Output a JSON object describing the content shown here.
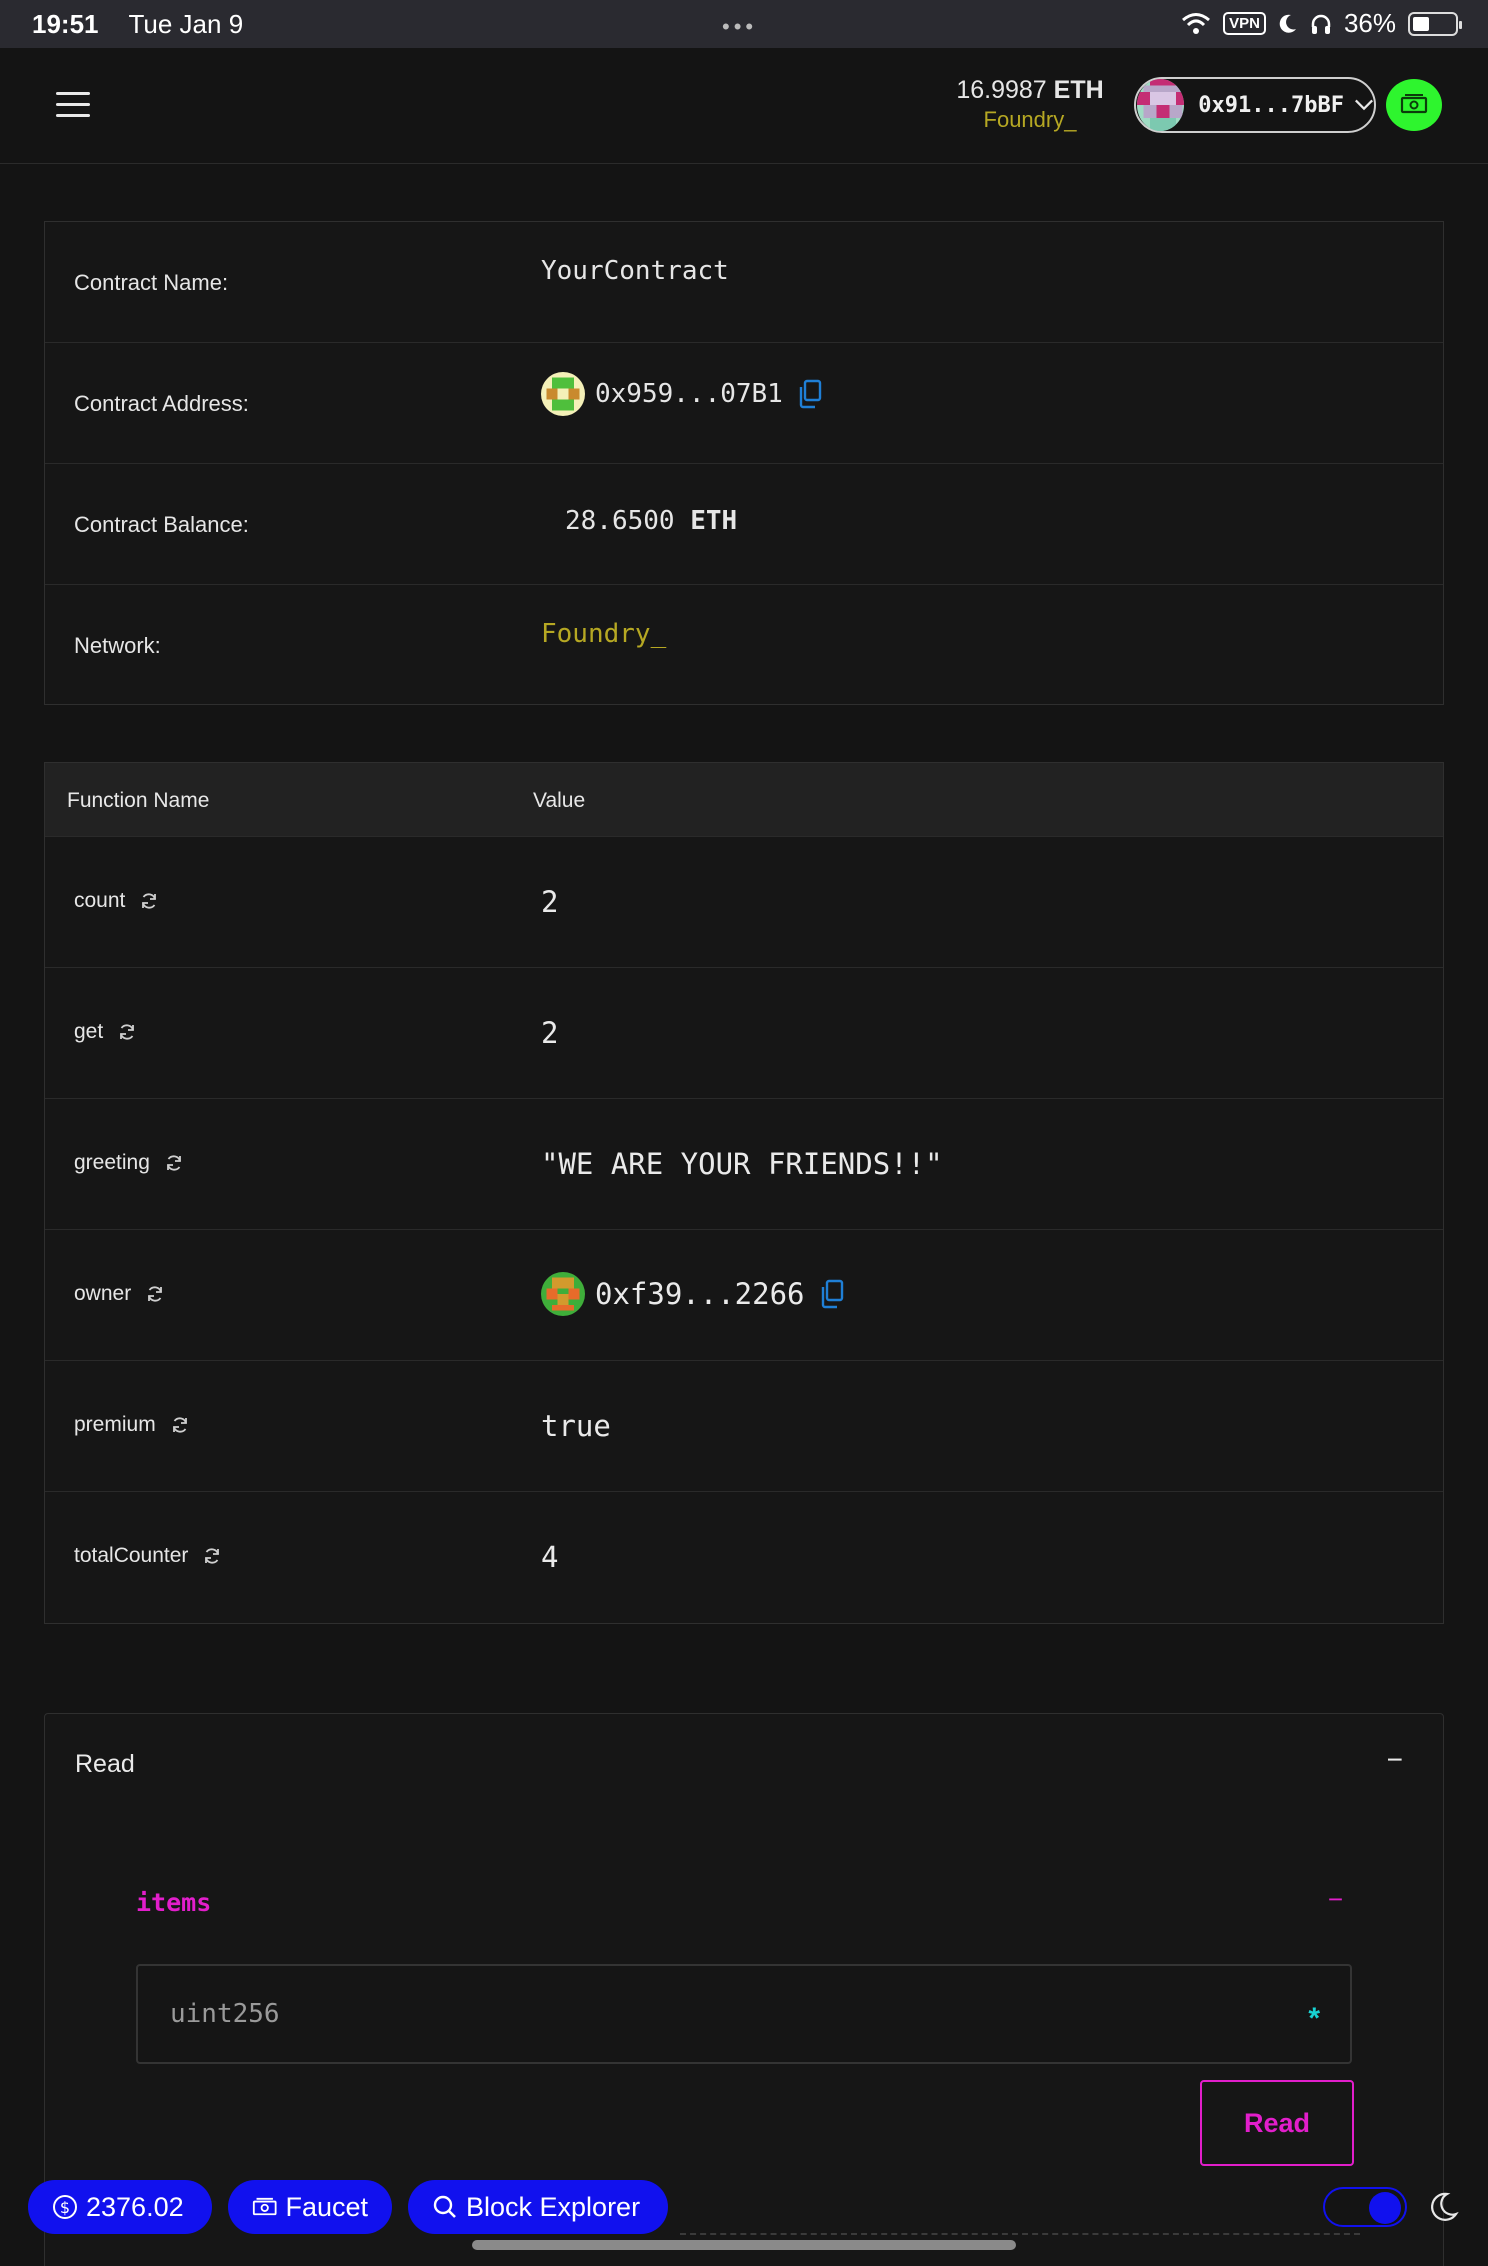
{
  "status_bar": {
    "time": "19:51",
    "date": "Tue Jan 9",
    "vpn": "VPN",
    "battery": "36%",
    "battery_level": 0.36
  },
  "header": {
    "balance_value": "16.9987",
    "balance_unit": "ETH",
    "network": "Foundry_",
    "account_address": "0x91...7bBF"
  },
  "contract": {
    "name_label": "Contract Name:",
    "name_value": "YourContract",
    "address_label": "Contract Address:",
    "address_value": "0x959...07B1",
    "balance_label": "Contract Balance:",
    "balance_value": "28.6500",
    "balance_unit": "ETH",
    "network_label": "Network:",
    "network_value": "Foundry_"
  },
  "functions_table": {
    "headers": [
      "Function Name",
      "Value"
    ],
    "rows": [
      {
        "name": "count",
        "value": "2"
      },
      {
        "name": "get",
        "value": "2"
      },
      {
        "name": "greeting",
        "value": "\"WE ARE YOUR FRIENDS!!\""
      },
      {
        "name": "owner",
        "value": "0xf39...2266"
      },
      {
        "name": "premium",
        "value": "true"
      },
      {
        "name": "totalCounter",
        "value": "4"
      }
    ]
  },
  "read_panel": {
    "title": "Read",
    "collapse": "−",
    "function_name": "items",
    "function_collapse": "−",
    "input_placeholder": "uint256",
    "required_marker": "*",
    "button_label": "Read"
  },
  "bottom_bar": {
    "price": "2376.02",
    "faucet_label": "Faucet",
    "explorer_label": "Block Explorer"
  },
  "colors": {
    "accent_magenta": "#e21ecb",
    "network_gold": "#b6a823",
    "button_blue": "#1111ee",
    "faucet_green": "#2ef52e",
    "copy_blue": "#1f7fd6"
  }
}
